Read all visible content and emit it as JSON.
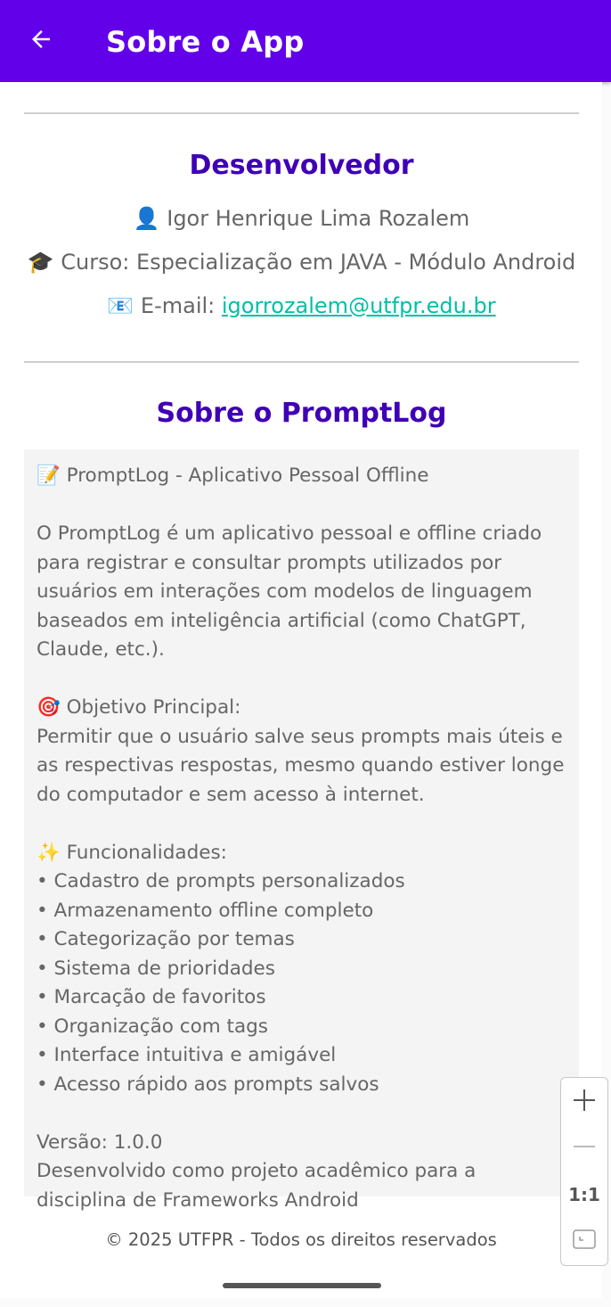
{
  "appbar": {
    "title": "Sobre o App",
    "back_icon": "arrow-back-icon",
    "background": "#6200ea"
  },
  "developer": {
    "heading": "Desenvolvedor",
    "name_icon": "👤",
    "name": "Igor Henrique Lima Rozalem",
    "course_icon": "🎓",
    "course": "Curso: Especialização em JAVA - Módulo Android",
    "email_icon": "📧",
    "email_label": "E-mail:",
    "email": "igorrozalem@utfpr.edu.br"
  },
  "about": {
    "heading": "Sobre o PromptLog",
    "description": "📝 PromptLog - Aplicativo Pessoal Offline\n\nO PromptLog é um aplicativo pessoal e offline criado para registrar e consultar prompts utilizados por usuários em interações com modelos de linguagem baseados em inteligência artificial (como ChatGPT, Claude, etc.).\n\n🎯 Objetivo Principal:\nPermitir que o usuário salve seus prompts mais úteis e as respectivas respostas, mesmo quando estiver longe do computador e sem acesso à internet.\n\n✨ Funcionalidades:\n• Cadastro de prompts personalizados\n• Armazenamento offline completo\n• Categorização por temas\n• Sistema de prioridades\n• Marcação de favoritos\n• Organização com tags\n• Interface intuitiva e amigável\n• Acesso rápido aos prompts salvos\n\nVersão: 1.0.0\nDesenvolvido como projeto acadêmico para a disciplina de Frameworks Android"
  },
  "footer": {
    "text": "© 2025 UTFPR - Todos os direitos reservados"
  },
  "zoom_controls": {
    "zoom_in_icon": "plus-icon",
    "zoom_out_icon": "minus-icon",
    "reset_label": "1:1",
    "fit_icon": "fit-screen-icon"
  },
  "colors": {
    "accent": "#6200ea",
    "heading": "#3f00b5",
    "link": "#00bfa5"
  }
}
